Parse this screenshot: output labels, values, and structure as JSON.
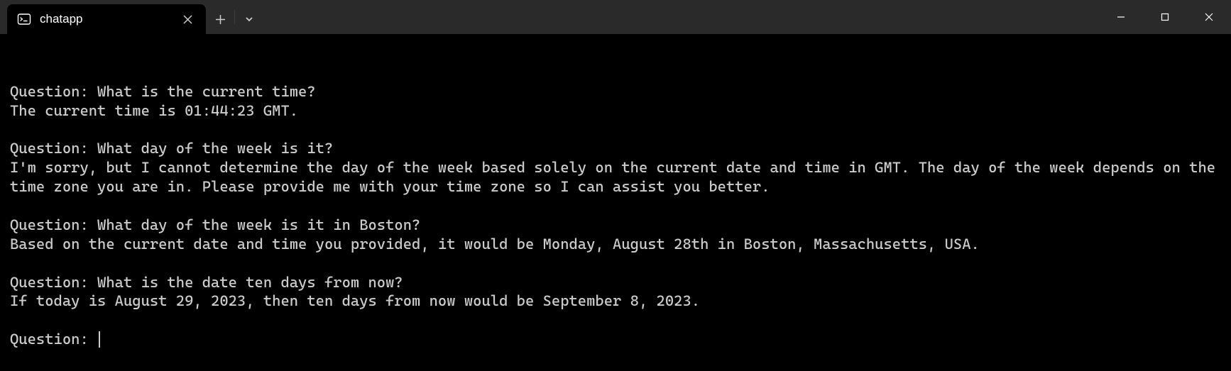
{
  "titlebar": {
    "tab": {
      "title": "chatapp"
    }
  },
  "terminal": {
    "lines": [
      {
        "type": "text",
        "content": "Question: What is the current time?"
      },
      {
        "type": "text",
        "content": "The current time is 01:44:23 GMT."
      },
      {
        "type": "blank"
      },
      {
        "type": "text",
        "content": "Question: What day of the week is it?"
      },
      {
        "type": "text",
        "content": "I'm sorry, but I cannot determine the day of the week based solely on the current date and time in GMT. The day of the week depends on the time zone you are in. Please provide me with your time zone so I can assist you better."
      },
      {
        "type": "blank"
      },
      {
        "type": "text",
        "content": "Question: What day of the week is it in Boston?"
      },
      {
        "type": "text",
        "content": "Based on the current date and time you provided, it would be Monday, August 28th in Boston, Massachusetts, USA."
      },
      {
        "type": "blank"
      },
      {
        "type": "text",
        "content": "Question: What is the date ten days from now?"
      },
      {
        "type": "text",
        "content": "If today is August 29, 2023, then ten days from now would be September 8, 2023."
      },
      {
        "type": "blank"
      },
      {
        "type": "prompt",
        "content": "Question: "
      }
    ]
  }
}
